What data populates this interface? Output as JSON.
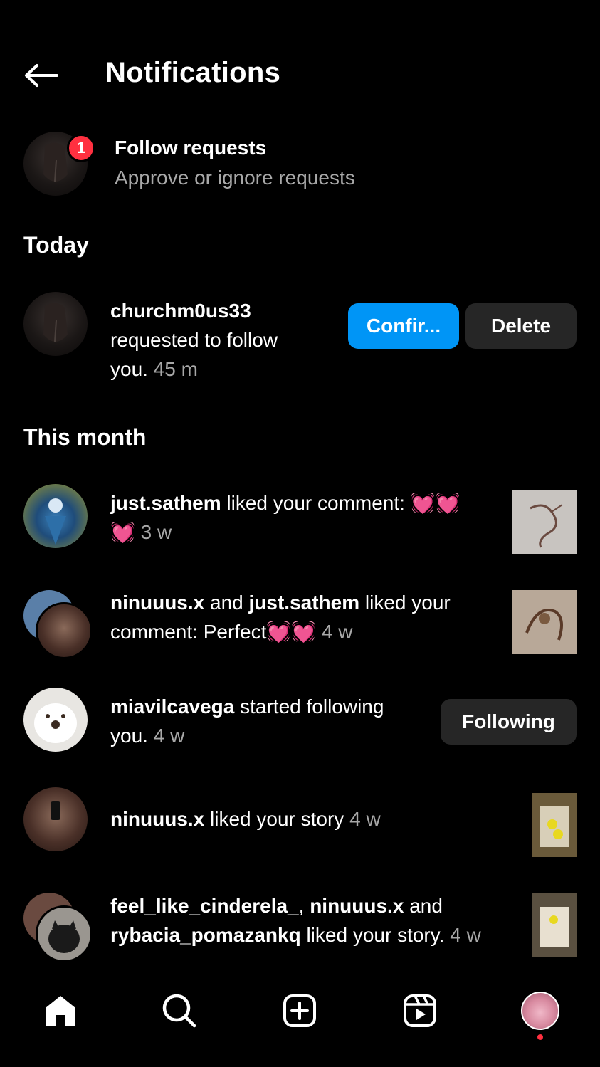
{
  "header": {
    "title": "Notifications"
  },
  "follow_requests": {
    "count": "1",
    "title": "Follow requests",
    "subtitle": "Approve or ignore requests"
  },
  "sections": {
    "today": "Today",
    "this_month": "This month"
  },
  "notifications": [
    {
      "user": "churchm0us33",
      "line1": "requested to follow",
      "line2": "you.",
      "time": "45 m",
      "confirm_label": "Confir...",
      "delete_label": "Delete"
    },
    {
      "user": "just.sathem",
      "text": " liked your comment: 💓💓",
      "line2": "💓",
      "time": "3 w"
    },
    {
      "user1": "ninuuus.x",
      "joiner": " and ",
      "user2": "just.sathem",
      "text": " liked your",
      "line2": "comment: Perfect💓💓",
      "time": "4 w"
    },
    {
      "user": "miavilcavega",
      "text": " started following",
      "line2": "you.",
      "time": "4 w",
      "button_label": "Following"
    },
    {
      "user": "ninuuus.x",
      "text": " liked your story",
      "time": "4 w"
    },
    {
      "user1": "feel_like_cinderela_",
      "joiner1": ", ",
      "user2": "ninuuus.x",
      "joiner2": " and",
      "user3": "rybacia_pomazankq",
      "text": " liked your story.",
      "time": "4 w"
    }
  ],
  "bottom_nav": [
    "home-icon",
    "search-icon",
    "create-icon",
    "reels-icon",
    "profile-avatar"
  ],
  "colors": {
    "accent": "#0095f6",
    "badge": "#ff3040",
    "button_grey": "#262626",
    "secondary_text": "#a8a8a8"
  }
}
